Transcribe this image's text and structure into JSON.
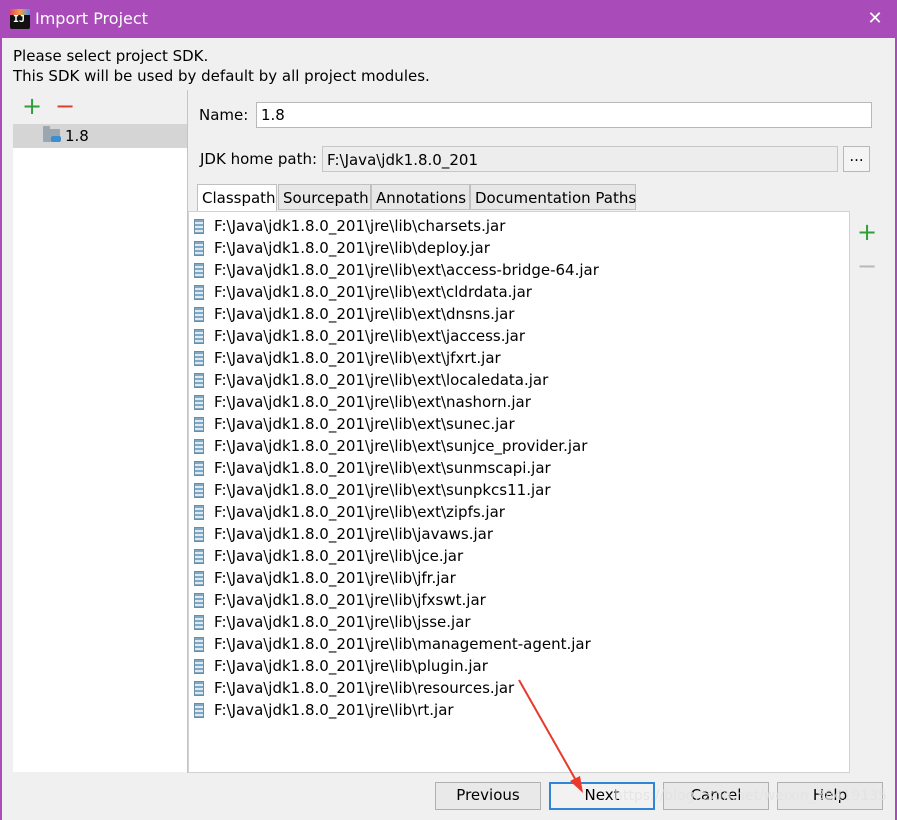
{
  "window": {
    "title": "Import Project",
    "icon": "intellij-icon",
    "close_glyph": "✕",
    "colors": {
      "titlebar": "#a94bb8",
      "accent": "#2f85d7",
      "add": "#2e9e36",
      "remove": "#d84030",
      "annotation_arrow": "#e8392a"
    }
  },
  "description": {
    "line1": "Please select project SDK.",
    "line2": "This SDK will be used by default by all project modules."
  },
  "sdk_toolbar": {
    "add_glyph": "+",
    "remove_glyph": "−"
  },
  "sdk_list": {
    "items": [
      {
        "label": "1.8",
        "icon": "sdk-folder-icon",
        "selected": true
      }
    ]
  },
  "form": {
    "name_label": "Name:",
    "name_value": "1.8",
    "jdk_label": "JDK home path:",
    "jdk_value": "F:\\Java\\jdk1.8.0_201",
    "browse_label": "..."
  },
  "tabs": [
    {
      "label": "Classpath",
      "active": true
    },
    {
      "label": "Sourcepath",
      "active": false
    },
    {
      "label": "Annotations",
      "active": false
    },
    {
      "label": "Documentation Paths",
      "active": false
    }
  ],
  "paths": [
    "F:\\Java\\jdk1.8.0_201\\jre\\lib\\charsets.jar",
    "F:\\Java\\jdk1.8.0_201\\jre\\lib\\deploy.jar",
    "F:\\Java\\jdk1.8.0_201\\jre\\lib\\ext\\access-bridge-64.jar",
    "F:\\Java\\jdk1.8.0_201\\jre\\lib\\ext\\cldrdata.jar",
    "F:\\Java\\jdk1.8.0_201\\jre\\lib\\ext\\dnsns.jar",
    "F:\\Java\\jdk1.8.0_201\\jre\\lib\\ext\\jaccess.jar",
    "F:\\Java\\jdk1.8.0_201\\jre\\lib\\ext\\jfxrt.jar",
    "F:\\Java\\jdk1.8.0_201\\jre\\lib\\ext\\localedata.jar",
    "F:\\Java\\jdk1.8.0_201\\jre\\lib\\ext\\nashorn.jar",
    "F:\\Java\\jdk1.8.0_201\\jre\\lib\\ext\\sunec.jar",
    "F:\\Java\\jdk1.8.0_201\\jre\\lib\\ext\\sunjce_provider.jar",
    "F:\\Java\\jdk1.8.0_201\\jre\\lib\\ext\\sunmscapi.jar",
    "F:\\Java\\jdk1.8.0_201\\jre\\lib\\ext\\sunpkcs11.jar",
    "F:\\Java\\jdk1.8.0_201\\jre\\lib\\ext\\zipfs.jar",
    "F:\\Java\\jdk1.8.0_201\\jre\\lib\\javaws.jar",
    "F:\\Java\\jdk1.8.0_201\\jre\\lib\\jce.jar",
    "F:\\Java\\jdk1.8.0_201\\jre\\lib\\jfr.jar",
    "F:\\Java\\jdk1.8.0_201\\jre\\lib\\jfxswt.jar",
    "F:\\Java\\jdk1.8.0_201\\jre\\lib\\jsse.jar",
    "F:\\Java\\jdk1.8.0_201\\jre\\lib\\management-agent.jar",
    "F:\\Java\\jdk1.8.0_201\\jre\\lib\\plugin.jar",
    "F:\\Java\\jdk1.8.0_201\\jre\\lib\\resources.jar",
    "F:\\Java\\jdk1.8.0_201\\jre\\lib\\rt.jar"
  ],
  "path_toolbar": {
    "add_glyph": "+",
    "remove_glyph": "−",
    "remove_enabled": false
  },
  "buttons": {
    "previous": "Previous",
    "next": "Next",
    "cancel": "Cancel",
    "help": "Help"
  },
  "watermark": "https://blog.csdn.net/weixin_38419135"
}
